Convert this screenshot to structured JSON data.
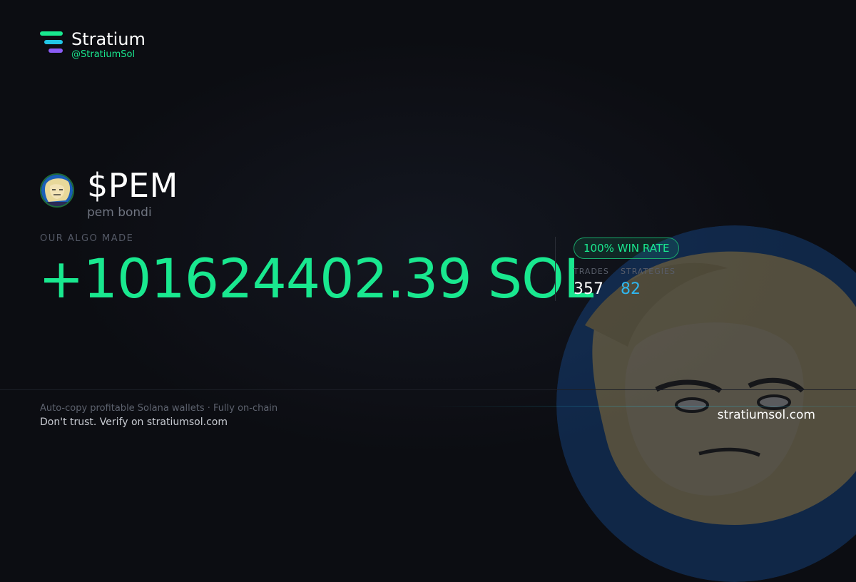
{
  "brand": {
    "name": "Stratium",
    "handle": "@StratiumSol"
  },
  "token": {
    "ticker": "$PEM",
    "name": "pem bondi",
    "avatar_icon": "token-avatar-portrait"
  },
  "result": {
    "label": "OUR ALGO MADE",
    "profit": "+101624402.39 SOL"
  },
  "stats": {
    "win_rate": "100% WIN RATE",
    "trades_label": "TRADES",
    "trades_value": "357",
    "strategies_label": "STRATEGIES",
    "strategies_value": "82"
  },
  "footer": {
    "tagline": "Auto-copy profitable Solana wallets · Fully on-chain",
    "verify": "Don't trust. Verify on stratiumsol.com",
    "site": "stratiumsol.com"
  },
  "colors": {
    "accent_green": "#19e88f",
    "accent_blue": "#2fb7f0",
    "background": "#0c0d12"
  }
}
